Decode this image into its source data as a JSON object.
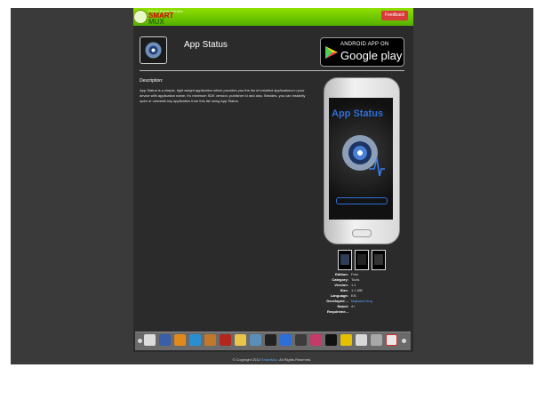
{
  "header": {
    "logo_tagline": "Find & Smart Solution",
    "logo_word1": "SMART",
    "logo_word2": "MUX",
    "feedback_label": "Feedback"
  },
  "app": {
    "title": "App Status",
    "store_badge_line1": "ANDROID APP ON",
    "store_badge_line2": "Google play",
    "description_heading": "Description:",
    "description": "App Status is a simple, light weight application which provides you the list of installed applications in your device with application name, it's minimum SDK version, publisher Id and also. Besides, you can instantly open or uninstall any application from this list using App Status."
  },
  "phone_screen": {
    "app_name": "App Status"
  },
  "details": [
    {
      "label": "Edition:",
      "value": "Free"
    },
    {
      "label": "Category:",
      "value": "Tools"
    },
    {
      "label": "Version:",
      "value": "1.1"
    },
    {
      "label": "Size:",
      "value": "1.1 MB"
    },
    {
      "label": "Language:",
      "value": "EN"
    },
    {
      "label": "Developed ...",
      "value": "Majharul Huq"
    },
    {
      "label": "Rated:",
      "value": "4+"
    },
    {
      "label": "Requireme...",
      "value": ""
    }
  ],
  "footer": {
    "copyright_prefix": "© Copyright 2012",
    "brand": "SmartMux",
    "copyright_suffix": ". All Rights Reserved."
  },
  "colors": {
    "topbar_green": "#6cc800",
    "feedback_red": "#d93a3a",
    "link_blue": "#5aa9ff",
    "screen_title_blue": "#2f6fd6"
  },
  "icons": {
    "logo": "smartmux-logo-icon",
    "app": "gear-status-icon",
    "store": "google-play-triangle-icon"
  }
}
